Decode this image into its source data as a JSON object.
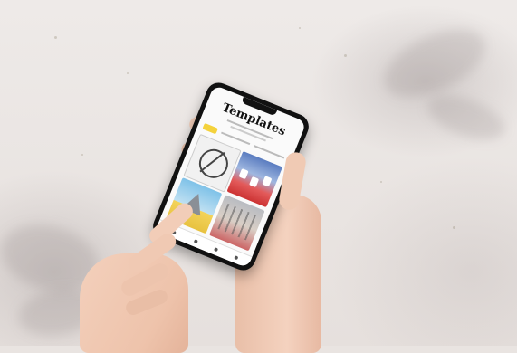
{
  "photo": {
    "subject": "hands-holding-smartphone",
    "background": "white-marble-wall",
    "phone_screen": {
      "app_title": "Templates"
    }
  },
  "colors": {
    "wall": "#e9e4e1",
    "skin": "#efc7b1",
    "phone_body": "#111111",
    "accent_chip": "#f4d23c"
  }
}
